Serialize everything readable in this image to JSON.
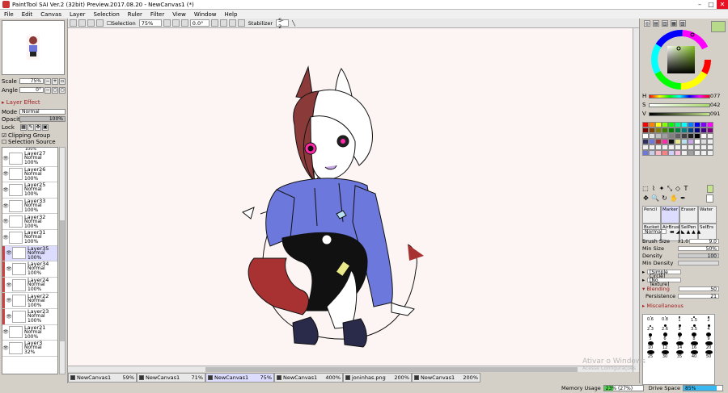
{
  "window": {
    "title": "PaintTool SAI Ver.2 (32bit) Preview.2017.08.20 - NewCanvas1 (*)"
  },
  "menu": [
    "File",
    "Edit",
    "Canvas",
    "Layer",
    "Selection",
    "Ruler",
    "Filter",
    "View",
    "Window",
    "Help"
  ],
  "toolbar": {
    "selection_label": "Selection",
    "zoom": "75%",
    "rotation": "0.0°",
    "stabilizer_label": "Stabilizer",
    "stabilizer_value": "S-2"
  },
  "navigator": {
    "scale_label": "Scale",
    "scale_value": "75%",
    "angle_label": "Angle",
    "angle_value": "0°"
  },
  "layer_panel": {
    "effect_header": "Layer Effect",
    "mode_label": "Mode",
    "mode_value": "Normal",
    "opacity_label": "Opacity",
    "opacity_value": "100%",
    "lock_label": "Lock",
    "clipping_group": "Clipping Group",
    "selection_source": "Selection Source",
    "top_partial": "100%",
    "layers": [
      {
        "name": "Layer27",
        "mode": "Normal",
        "opacity": "100%",
        "clip": false
      },
      {
        "name": "Layer26",
        "mode": "Normal",
        "opacity": "100%",
        "clip": false
      },
      {
        "name": "Layer25",
        "mode": "Normal",
        "opacity": "100%",
        "clip": false
      },
      {
        "name": "Layer33",
        "mode": "Normal",
        "opacity": "100%",
        "clip": false
      },
      {
        "name": "Layer32",
        "mode": "Normal",
        "opacity": "100%",
        "clip": false
      },
      {
        "name": "Layer31",
        "mode": "Normal",
        "opacity": "100%",
        "clip": false
      },
      {
        "name": "Layer35",
        "mode": "Normal",
        "opacity": "100%",
        "clip": true,
        "selected": true
      },
      {
        "name": "Layer34",
        "mode": "Normal",
        "opacity": "100%",
        "clip": true
      },
      {
        "name": "Layer24",
        "mode": "Normal",
        "opacity": "100%",
        "clip": true
      },
      {
        "name": "Layer22",
        "mode": "Normal",
        "opacity": "100%",
        "clip": true
      },
      {
        "name": "Layer23",
        "mode": "Normal",
        "opacity": "100%",
        "clip": true
      },
      {
        "name": "Layer21",
        "mode": "Normal",
        "opacity": "100%",
        "clip": false
      },
      {
        "name": "Layer3",
        "mode": "Normal",
        "opacity": "32%",
        "clip": false
      }
    ]
  },
  "tabs": [
    {
      "name": "NewCanvas1",
      "zoom": "59%"
    },
    {
      "name": "NewCanvas1",
      "zoom": "71%"
    },
    {
      "name": "NewCanvas1",
      "zoom": "75%",
      "active": true
    },
    {
      "name": "NewCanvas1",
      "zoom": "400%"
    },
    {
      "name": "joninhas.png",
      "zoom": "200%"
    },
    {
      "name": "NewCanvas1",
      "zoom": "200%"
    }
  ],
  "status": {
    "memory_label": "Memory Usage",
    "memory_value": "23% (27%)",
    "drive_label": "Drive Space",
    "drive_value": "85%",
    "memory_fraction": 0.23,
    "drive_fraction": 0.85
  },
  "color": {
    "h_label": "H",
    "h_value": "077",
    "s_label": "S",
    "s_value": "042",
    "v_label": "V",
    "v_value": "091",
    "current": "#c5e48c"
  },
  "brushes": [
    {
      "name": "Pencil"
    },
    {
      "name": "Marker",
      "selected": true
    },
    {
      "name": "Eraser"
    },
    {
      "name": "Water"
    },
    {
      "name": "Bucket"
    },
    {
      "name": "AirBrush"
    },
    {
      "name": "SelPen"
    },
    {
      "name": "SelErs"
    }
  ],
  "brush_props": {
    "blend_mode": "Normal",
    "size_label": "Brush Size",
    "size_mult": "x1.0",
    "size_value": "9.0",
    "minsize_label": "Min Size",
    "minsize_value": "50%",
    "density_label": "Density",
    "density_value": "100",
    "mindensity_label": "Min Density",
    "shape": "[Simple Circle]",
    "texture": "[No Texture]",
    "blending_header": "Blending",
    "blending_value": "50",
    "persistence_label": "Persistence",
    "persistence_value": "21",
    "misc_header": "Miscellaneous"
  },
  "brush_sizes": [
    "0.6",
    "0.8",
    "1",
    "1.5",
    "2",
    "2.3",
    "2.6",
    "3",
    "3.5",
    "4",
    "5",
    "6",
    "7",
    "8",
    "9",
    "10",
    "12",
    "14",
    "16",
    "20",
    "25",
    "30",
    "35",
    "40",
    "50"
  ],
  "watermark": {
    "line1": "Ativar o Windows",
    "line2": "Acesse Configurações"
  }
}
